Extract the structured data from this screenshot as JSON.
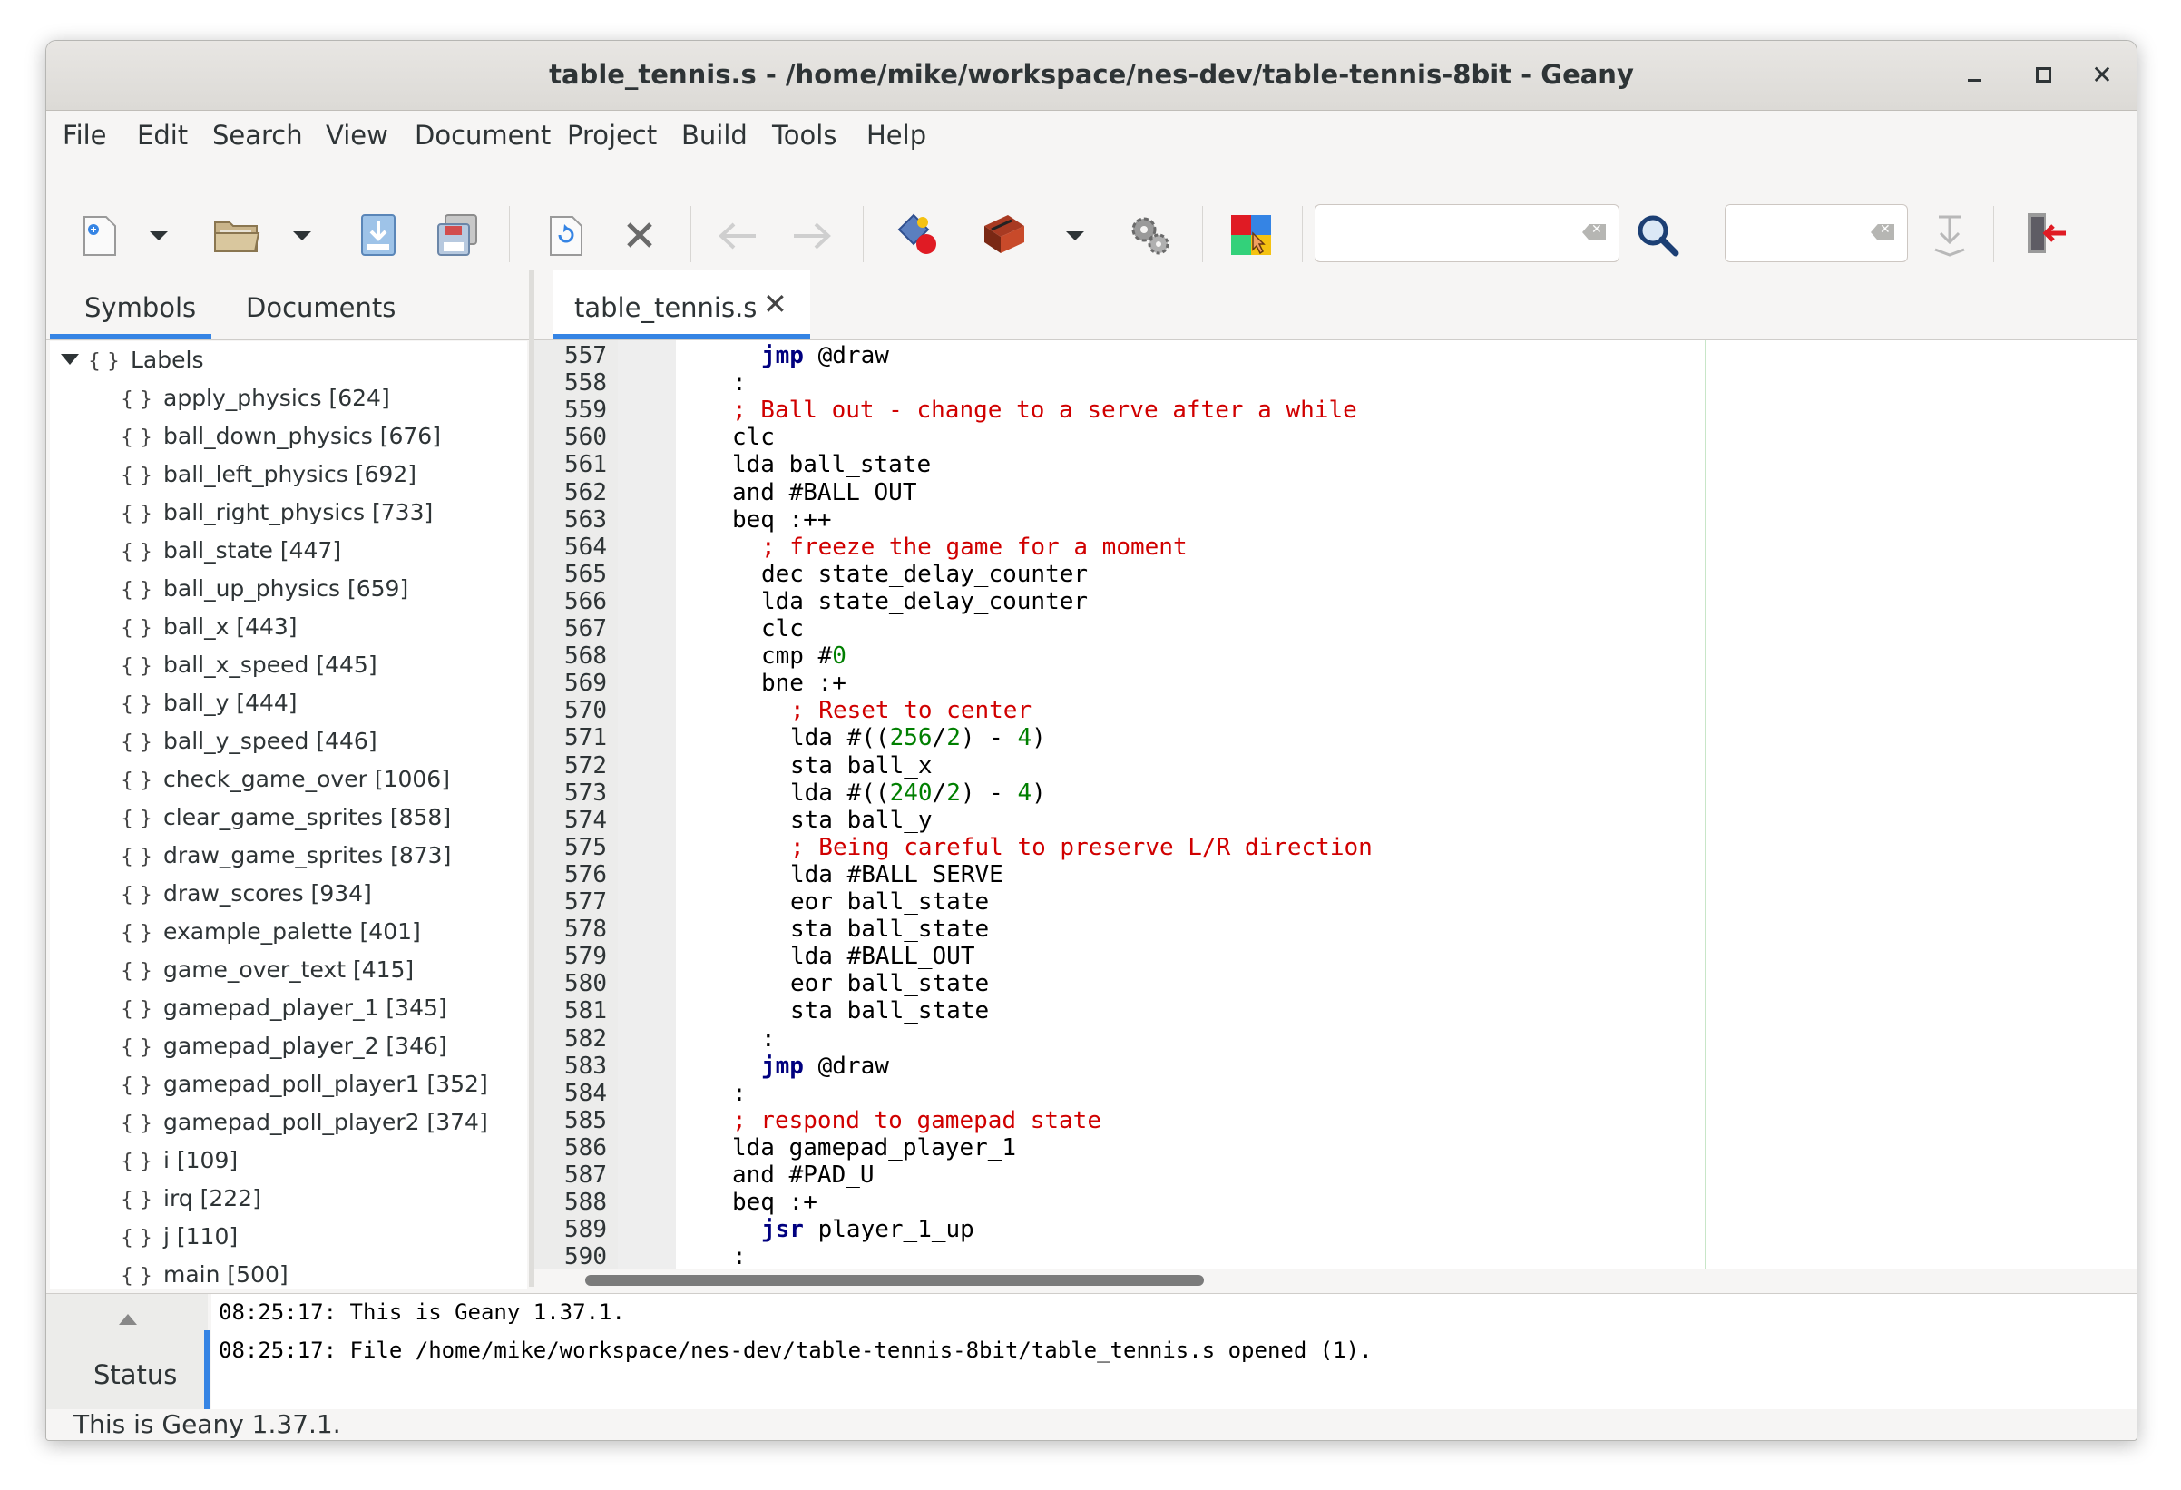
{
  "window": {
    "title": "table_tennis.s - /home/mike/workspace/nes-dev/table-tennis-8bit - Geany",
    "close_glyph": "✕"
  },
  "menu": [
    "File",
    "Edit",
    "Search",
    "View",
    "Document",
    "Project",
    "Build",
    "Tools",
    "Help"
  ],
  "toolbar": {
    "icons": [
      "new-file-icon",
      "open-file-icon",
      "save-file-icon",
      "save-all-icon",
      "revert-icon",
      "close-file-icon",
      "navigate-back-icon",
      "navigate-forward-icon",
      "compile-icon",
      "build-icon",
      "execute-icon",
      "color-chooser-icon",
      "search-icon",
      "jump-to-line-icon",
      "quit-icon"
    ],
    "search_value": "",
    "goto_value": ""
  },
  "sidebar": {
    "tabs": [
      "Symbols",
      "Documents"
    ],
    "active_tab": "Symbols",
    "root": "Labels",
    "symbol_glyph": "{ }",
    "items": [
      "apply_physics [624]",
      "ball_down_physics [676]",
      "ball_left_physics [692]",
      "ball_right_physics [733]",
      "ball_state [447]",
      "ball_up_physics [659]",
      "ball_x [443]",
      "ball_x_speed [445]",
      "ball_y [444]",
      "ball_y_speed [446]",
      "check_game_over [1006]",
      "clear_game_sprites [858]",
      "draw_game_sprites [873]",
      "draw_scores [934]",
      "example_palette [401]",
      "game_over_text [415]",
      "gamepad_player_1 [345]",
      "gamepad_player_2 [346]",
      "gamepad_poll_player1 [352]",
      "gamepad_poll_player2 [374]",
      "i [109]",
      "irq [222]",
      "j [110]",
      "main [500]"
    ]
  },
  "editor": {
    "tab_label": "table_tennis.s",
    "tab_close": "✕",
    "colors": {
      "keyword": "#00007f",
      "comment": "#d00000",
      "number": "#007f00"
    },
    "lines": [
      {
        "n": "557",
        "indent": 1,
        "tokens": [
          {
            "t": "jmp",
            "c": "kw"
          },
          {
            "t": " @draw",
            "c": ""
          }
        ]
      },
      {
        "n": "558",
        "indent": 0,
        "tokens": [
          {
            "t": ":",
            "c": ""
          }
        ]
      },
      {
        "n": "559",
        "indent": 0,
        "tokens": [
          {
            "t": "; Ball out - change to a serve after a while",
            "c": "cm"
          }
        ]
      },
      {
        "n": "560",
        "indent": 0,
        "tokens": [
          {
            "t": "clc",
            "c": ""
          }
        ]
      },
      {
        "n": "561",
        "indent": 0,
        "tokens": [
          {
            "t": "lda ball_state",
            "c": ""
          }
        ]
      },
      {
        "n": "562",
        "indent": 0,
        "tokens": [
          {
            "t": "and #BALL_OUT",
            "c": ""
          }
        ]
      },
      {
        "n": "563",
        "indent": 0,
        "tokens": [
          {
            "t": "beq :++",
            "c": ""
          }
        ]
      },
      {
        "n": "564",
        "indent": 1,
        "tokens": [
          {
            "t": "; freeze the game for a moment",
            "c": "cm"
          }
        ]
      },
      {
        "n": "565",
        "indent": 1,
        "tokens": [
          {
            "t": "dec state_delay_counter",
            "c": ""
          }
        ]
      },
      {
        "n": "566",
        "indent": 1,
        "tokens": [
          {
            "t": "lda state_delay_counter",
            "c": ""
          }
        ]
      },
      {
        "n": "567",
        "indent": 1,
        "tokens": [
          {
            "t": "clc",
            "c": ""
          }
        ]
      },
      {
        "n": "568",
        "indent": 1,
        "tokens": [
          {
            "t": "cmp #",
            "c": ""
          },
          {
            "t": "0",
            "c": "num"
          }
        ]
      },
      {
        "n": "569",
        "indent": 1,
        "tokens": [
          {
            "t": "bne :+",
            "c": ""
          }
        ]
      },
      {
        "n": "570",
        "indent": 2,
        "tokens": [
          {
            "t": "; Reset to center",
            "c": "cm"
          }
        ]
      },
      {
        "n": "571",
        "indent": 2,
        "tokens": [
          {
            "t": "lda #((",
            "c": ""
          },
          {
            "t": "256",
            "c": "num"
          },
          {
            "t": "/",
            "c": ""
          },
          {
            "t": "2",
            "c": "num"
          },
          {
            "t": ") - ",
            "c": ""
          },
          {
            "t": "4",
            "c": "num"
          },
          {
            "t": ")",
            "c": ""
          }
        ]
      },
      {
        "n": "572",
        "indent": 2,
        "tokens": [
          {
            "t": "sta ball_x",
            "c": ""
          }
        ]
      },
      {
        "n": "573",
        "indent": 2,
        "tokens": [
          {
            "t": "lda #((",
            "c": ""
          },
          {
            "t": "240",
            "c": "num"
          },
          {
            "t": "/",
            "c": ""
          },
          {
            "t": "2",
            "c": "num"
          },
          {
            "t": ") - ",
            "c": ""
          },
          {
            "t": "4",
            "c": "num"
          },
          {
            "t": ")",
            "c": ""
          }
        ]
      },
      {
        "n": "574",
        "indent": 2,
        "tokens": [
          {
            "t": "sta ball_y",
            "c": ""
          }
        ]
      },
      {
        "n": "575",
        "indent": 2,
        "tokens": [
          {
            "t": "; Being careful to preserve L/R direction",
            "c": "cm"
          }
        ]
      },
      {
        "n": "576",
        "indent": 2,
        "tokens": [
          {
            "t": "lda #BALL_SERVE",
            "c": ""
          }
        ]
      },
      {
        "n": "577",
        "indent": 2,
        "tokens": [
          {
            "t": "eor ball_state",
            "c": ""
          }
        ]
      },
      {
        "n": "578",
        "indent": 2,
        "tokens": [
          {
            "t": "sta ball_state",
            "c": ""
          }
        ]
      },
      {
        "n": "579",
        "indent": 2,
        "tokens": [
          {
            "t": "lda #BALL_OUT",
            "c": ""
          }
        ]
      },
      {
        "n": "580",
        "indent": 2,
        "tokens": [
          {
            "t": "eor ball_state",
            "c": ""
          }
        ]
      },
      {
        "n": "581",
        "indent": 2,
        "tokens": [
          {
            "t": "sta ball_state",
            "c": ""
          }
        ]
      },
      {
        "n": "582",
        "indent": 1,
        "tokens": [
          {
            "t": ":",
            "c": ""
          }
        ]
      },
      {
        "n": "583",
        "indent": 1,
        "tokens": [
          {
            "t": "jmp",
            "c": "kw"
          },
          {
            "t": " @draw",
            "c": ""
          }
        ]
      },
      {
        "n": "584",
        "indent": 0,
        "tokens": [
          {
            "t": ":",
            "c": ""
          }
        ]
      },
      {
        "n": "585",
        "indent": 0,
        "tokens": [
          {
            "t": "; respond to gamepad state",
            "c": "cm"
          }
        ]
      },
      {
        "n": "586",
        "indent": 0,
        "tokens": [
          {
            "t": "lda gamepad_player_1",
            "c": ""
          }
        ]
      },
      {
        "n": "587",
        "indent": 0,
        "tokens": [
          {
            "t": "and #PAD_U",
            "c": ""
          }
        ]
      },
      {
        "n": "588",
        "indent": 0,
        "tokens": [
          {
            "t": "beq :+",
            "c": ""
          }
        ]
      },
      {
        "n": "589",
        "indent": 1,
        "tokens": [
          {
            "t": "jsr",
            "c": "kw"
          },
          {
            "t": " player_1_up",
            "c": ""
          }
        ]
      },
      {
        "n": "590",
        "indent": 0,
        "tokens": [
          {
            "t": ":",
            "c": ""
          }
        ]
      }
    ]
  },
  "messages": {
    "tab_label": "Status",
    "lines": [
      "08:25:17: This is Geany 1.37.1.",
      "08:25:17: File /home/mike/workspace/nes-dev/table-tennis-8bit/table_tennis.s opened (1)."
    ]
  },
  "statusbar": {
    "text": "This is Geany 1.37.1."
  }
}
